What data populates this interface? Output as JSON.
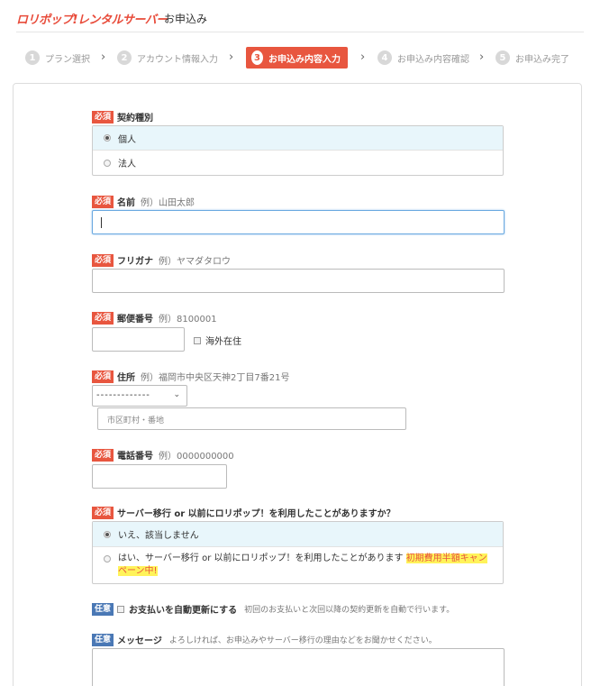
{
  "header": {
    "logo": "ロリポップ!レンタルサーバー",
    "title": "お申込み"
  },
  "steps": [
    {
      "num": "1",
      "label": "プラン選択"
    },
    {
      "num": "2",
      "label": "アカウント情報入力"
    },
    {
      "num": "3",
      "label": "お申込み内容入力"
    },
    {
      "num": "4",
      "label": "お申込み内容確認"
    },
    {
      "num": "5",
      "label": "お申込み完了"
    }
  ],
  "step_arrow": "›",
  "badges": {
    "required": "必須",
    "optional": "任意"
  },
  "contract": {
    "label": "契約種別",
    "options": [
      "個人",
      "法人"
    ]
  },
  "name": {
    "label": "名前",
    "example": "例）山田太郎"
  },
  "furigana": {
    "label": "フリガナ",
    "example": "例）ヤマダタロウ"
  },
  "postal": {
    "label": "郵便番号",
    "example": "例）8100001",
    "overseas": "海外在住"
  },
  "address": {
    "label": "住所",
    "example": "例）福岡市中央区天神2丁目7番21号",
    "prefecture_value": "-------------",
    "chevron": "⌄",
    "city_placeholder": "市区町村・番地"
  },
  "phone": {
    "label": "電話番号",
    "example": "例）0000000000"
  },
  "migration": {
    "label": "サーバー移行 or 以前にロリポップ！を利用したことがありますか？",
    "option_no": "いえ、該当しません",
    "option_yes": "はい、サーバー移行 or 以前にロリポップ！を利用したことがあります",
    "campaign_line1": "初期費用半額キャン",
    "campaign_line2": "ペーン中!"
  },
  "autorenew": {
    "label": "お支払いを自動更新にする",
    "desc": "初回のお支払いと次回以降の契約更新を自動で行います。"
  },
  "message": {
    "label": "メッセージ",
    "desc": "よろしければ、お申込みやサーバー移行の理由などをお聞かせください。"
  },
  "colors": {
    "accent": "#e8563f",
    "optional_badge": "#4a78b5",
    "focus": "#6aa9e0",
    "highlight": "#fff35a"
  }
}
